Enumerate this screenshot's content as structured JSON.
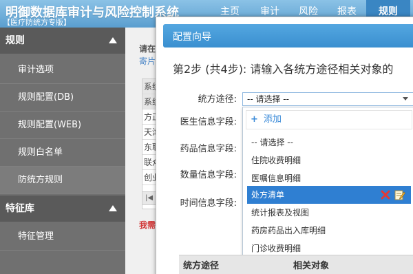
{
  "header": {
    "title": "明御数据库审计与风险控制系统",
    "subtitle": "【医疗防统方专版】",
    "nav": [
      "主页",
      "审计",
      "风险",
      "报表",
      "规则"
    ],
    "active_nav": "规则"
  },
  "sidebar": {
    "sections": [
      {
        "label": "规则",
        "items": [
          "审计选项",
          "规则配置(DB)",
          "规则配置(WEB)",
          "规则白名单",
          "防统方规则"
        ]
      },
      {
        "label": "特征库",
        "items": [
          "特征管理"
        ]
      }
    ],
    "active_item": "防统方规则"
  },
  "background": {
    "please_label": "请在",
    "link_text": "寄片",
    "table_cells": [
      "系统",
      "系统",
      "方正",
      "天津",
      "东联",
      "联众",
      "创业"
    ],
    "pager": "|◀",
    "warning": "我需"
  },
  "modal": {
    "title": "配置向导",
    "step_text": "第2步 (共4步): 请输入各统方途径相关对象的",
    "fields": {
      "route": "统方途径:",
      "doctor": "医生信息字段:",
      "drug": "药品信息字段:",
      "quantity": "数量信息字段:",
      "time": "时间信息字段:"
    },
    "select_value": "-- 请选择 --",
    "add_label": "添加",
    "options": [
      "-- 请选择 --",
      "住院收费明细",
      "医嘱信息明细",
      "处方清单",
      "统计报表及视图",
      "药房药品出入库明细",
      "门诊收费明细"
    ],
    "selected_option": "处方清单",
    "columns": [
      "统方途径",
      "相关对象"
    ]
  },
  "colors": {
    "header_blue": "#5a9ecf",
    "modal_blue": "#3a8fd0",
    "selected_blue": "#2f7fd2",
    "sidebar_gray": "#707070",
    "warn_red": "#d23a3a"
  }
}
